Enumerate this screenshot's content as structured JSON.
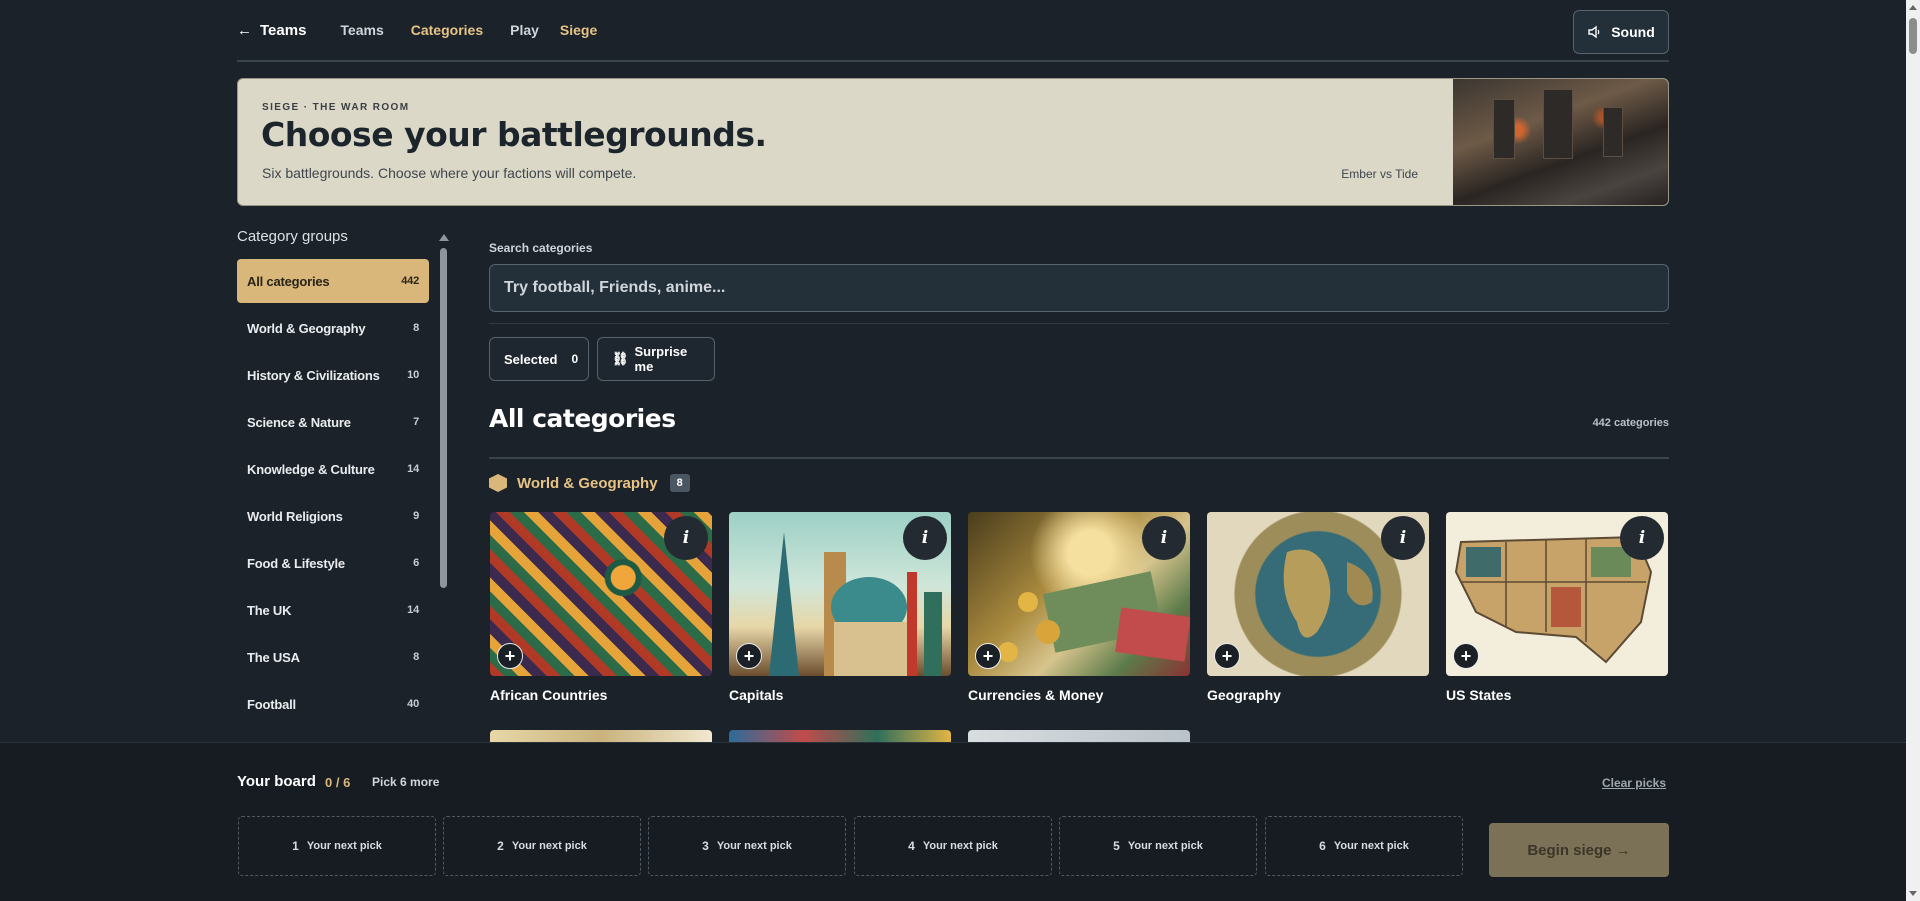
{
  "nav": {
    "back_label": "Teams",
    "links": [
      "Teams",
      "Categories",
      "Play"
    ],
    "mode": "Siege",
    "sound_label": "Sound"
  },
  "hero": {
    "kicker": "SIEGE · THE WAR ROOM",
    "title": "Choose your battlegrounds.",
    "subtitle": "Six battlegrounds. Choose where your factions will compete.",
    "matchup": "Ember vs Tide"
  },
  "sidebar": {
    "title": "Category groups",
    "items": [
      {
        "label": "All categories",
        "count": "442"
      },
      {
        "label": "World & Geography",
        "count": "8"
      },
      {
        "label": "History & Civilizations",
        "count": "10"
      },
      {
        "label": "Science & Nature",
        "count": "7"
      },
      {
        "label": "Knowledge & Culture",
        "count": "14"
      },
      {
        "label": "World Religions",
        "count": "9"
      },
      {
        "label": "Food & Lifestyle",
        "count": "6"
      },
      {
        "label": "The UK",
        "count": "14"
      },
      {
        "label": "The USA",
        "count": "8"
      },
      {
        "label": "Football",
        "count": "40"
      }
    ]
  },
  "search": {
    "label": "Search categories",
    "placeholder": "Try football, Friends, anime..."
  },
  "filters": {
    "selected_label": "Selected",
    "selected_count": "0",
    "surprise_label": "Surprise me"
  },
  "section": {
    "title": "All categories",
    "count_label": "442 categories"
  },
  "group": {
    "name": "World & Geography",
    "count": "8",
    "cards": [
      {
        "name": "African Countries"
      },
      {
        "name": "Capitals"
      },
      {
        "name": "Currencies & Money"
      },
      {
        "name": "Geography"
      },
      {
        "name": "US States"
      }
    ]
  },
  "board": {
    "title": "Your board",
    "count": "0 / 6",
    "remaining": "Pick 6 more",
    "clear_label": "Clear picks",
    "slots": [
      {
        "num": "1",
        "label": "Your next pick"
      },
      {
        "num": "2",
        "label": "Your next pick"
      },
      {
        "num": "3",
        "label": "Your next pick"
      },
      {
        "num": "4",
        "label": "Your next pick"
      },
      {
        "num": "5",
        "label": "Your next pick"
      },
      {
        "num": "6",
        "label": "Your next pick"
      }
    ],
    "begin_label": "Begin siege →"
  },
  "colors": {
    "background": "#1b2229",
    "accent": "#d9b77a",
    "hero_bg": "#dcd8c7"
  }
}
